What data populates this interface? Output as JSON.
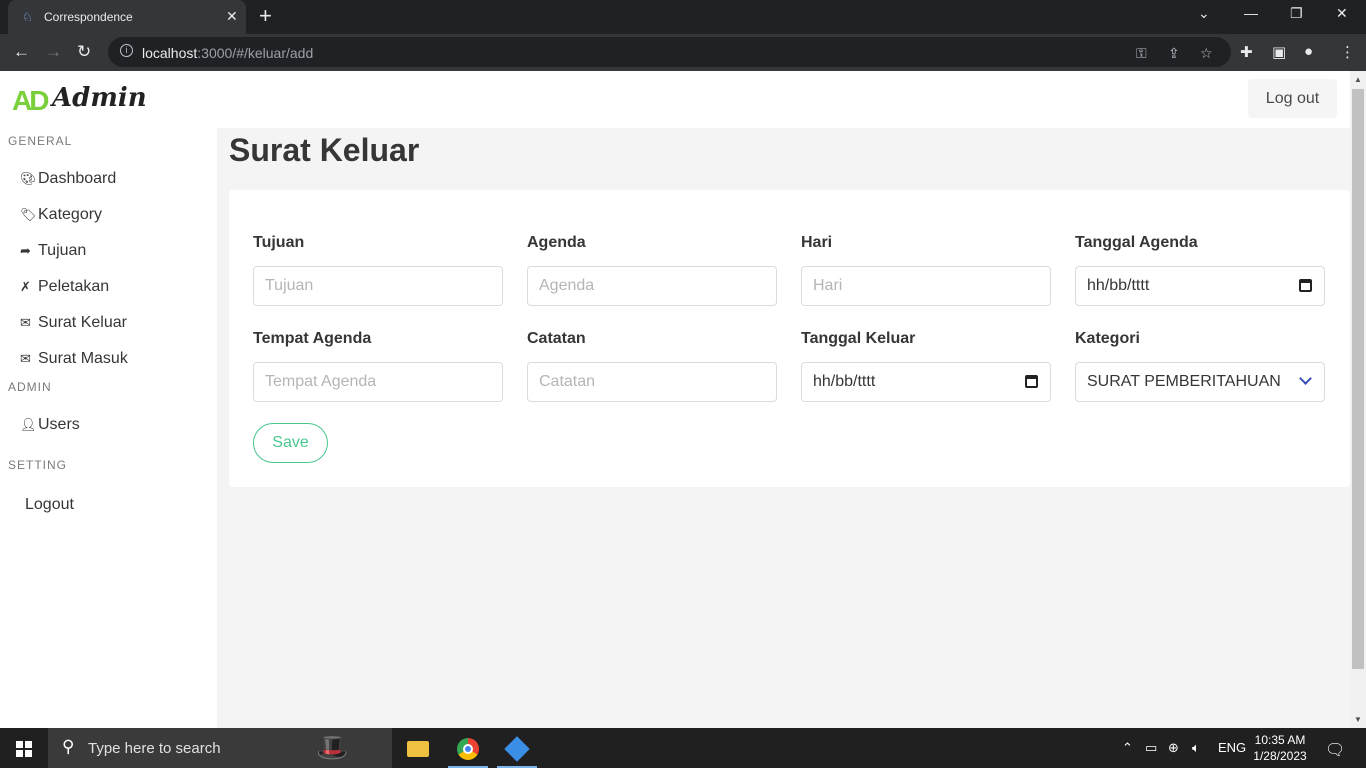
{
  "browser": {
    "tab_title": "Correspondence",
    "url_host": "localhost",
    "url_rest": ":3000/#/keluar/add"
  },
  "header": {
    "logo_text": "Admin",
    "logo_mark": "AD",
    "logout_label": "Log out"
  },
  "sidebar": {
    "general_label": "GENERAL",
    "admin_label": "ADMIN",
    "setting_label": "SETTING",
    "items": [
      {
        "label": "Dashboard",
        "icon": "palette-icon"
      },
      {
        "label": "Kategory",
        "icon": "tag-icon"
      },
      {
        "label": "Tujuan",
        "icon": "share-icon"
      },
      {
        "label": "Peletakan",
        "icon": "xing-icon"
      },
      {
        "label": "Surat Keluar",
        "icon": "envelope-icon"
      },
      {
        "label": "Surat Masuk",
        "icon": "envelope-open-icon"
      }
    ],
    "admin_items": [
      {
        "label": "Users",
        "icon": "user-icon"
      }
    ],
    "setting_items": [
      {
        "label": "Logout"
      }
    ]
  },
  "main": {
    "title": "Surat Keluar",
    "form": {
      "tujuan": {
        "label": "Tujuan",
        "placeholder": "Tujuan"
      },
      "agenda": {
        "label": "Agenda",
        "placeholder": "Agenda"
      },
      "hari": {
        "label": "Hari",
        "placeholder": "Hari"
      },
      "tanggal_agenda": {
        "label": "Tanggal Agenda",
        "value": "hh/bb/tttt"
      },
      "tempat_agenda": {
        "label": "Tempat Agenda",
        "placeholder": "Tempat Agenda"
      },
      "catatan": {
        "label": "Catatan",
        "placeholder": "Catatan"
      },
      "tanggal_keluar": {
        "label": "Tanggal Keluar",
        "value": "hh/bb/tttt"
      },
      "kategori": {
        "label": "Kategori",
        "value": "SURAT PEMBERITAHUAN"
      },
      "save_label": "Save"
    }
  },
  "taskbar": {
    "search_placeholder": "Type here to search",
    "lang": "ENG",
    "time": "10:35 AM",
    "date": "1/28/2023"
  },
  "colors": {
    "accent_green": "#48c78e",
    "logo_green": "#7ad03a",
    "chevron_blue": "#3850b7"
  }
}
